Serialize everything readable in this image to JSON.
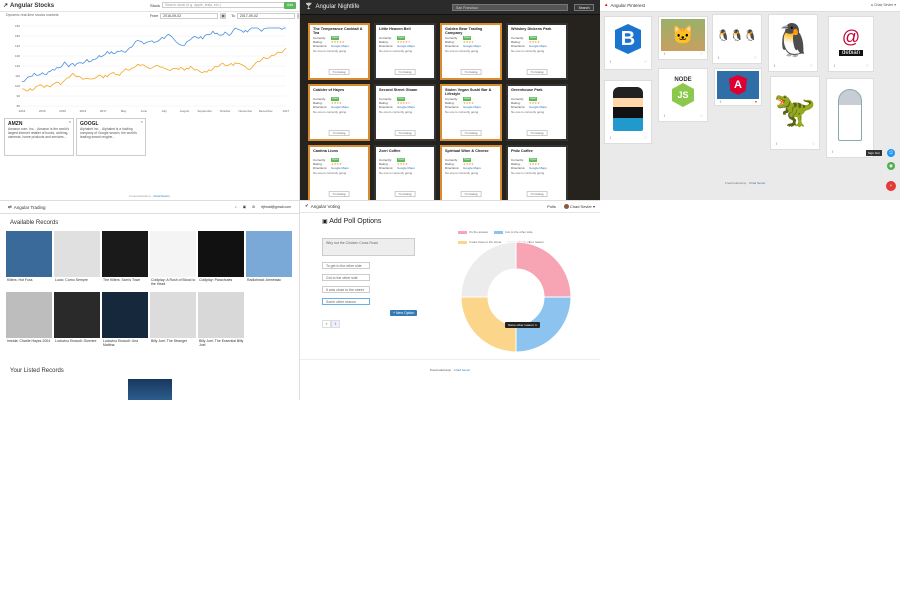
{
  "stocks": {
    "brand": "Angular Stocks",
    "subtitle": "Dynamic real-time stocks markets",
    "search_label": "Stock",
    "search_placeholder": "Search stock (e.g. apple, tesla, etc.)",
    "add_label": "Add",
    "from_label": "From",
    "from_value": "2016-09-02",
    "to_label": "To",
    "to_value": "2017-09-02",
    "x_ticks": [
      "2016",
      "2016",
      "2016",
      "2016",
      "2017",
      "May",
      "June",
      "July",
      "August",
      "September",
      "October",
      "November",
      "December",
      "2017"
    ],
    "y_ticks": [
      "160",
      "150",
      "140",
      "130",
      "120",
      "110",
      "100",
      "90",
      "80"
    ],
    "cards": [
      {
        "symbol": "AMZN",
        "text": "Amazon.com, Inc. - Amazon is the world's largest internet retailer of books, clothing, cameras, home products and services..."
      },
      {
        "symbol": "GOOGL",
        "text": "Alphabet Inc. - Alphabet is a holding company of Google search, the world's leading search engine..."
      }
    ],
    "footer_text": "FreeCodeCamp",
    "footer_author": "Chad Sevier",
    "series_colors": {
      "amzn": "#4a90e2",
      "googl": "#f5a623"
    }
  },
  "nightlife": {
    "brand": "Angular Nightlife",
    "search_placeholder": "San Francisco",
    "search_button": "Search",
    "labels": {
      "currently": "Currently:",
      "rating": "Rating:",
      "directions": "Directions:",
      "going": "I'm Going",
      "open": "Open",
      "maps": "Google Maps",
      "reviews": "No one is currently going"
    },
    "bars": [
      {
        "name": "The Temperance Cocktail & Tea",
        "stars": "★★★★★",
        "dark": false
      },
      {
        "name": "Little Heaven Bell",
        "stars": "★★★★½",
        "dark": true
      },
      {
        "name": "Golden Bear Trading Company",
        "stars": "★★★★",
        "dark": false
      },
      {
        "name": "Whiskey Dickens Park",
        "stars": "★★★★",
        "dark": true
      },
      {
        "name": "Cobbler of Hayes",
        "stars": "★★★★",
        "dark": false
      },
      {
        "name": "Second Street Gloam",
        "stars": "★★★★½",
        "dark": true
      },
      {
        "name": "Stolen Vegan Sushi Bar & Lifestyle",
        "stars": "★★★★",
        "dark": false
      },
      {
        "name": "Greenhouse Park",
        "stars": "★★★★",
        "dark": true
      },
      {
        "name": "Cantina Lions",
        "stars": "★★★★",
        "dark": false
      },
      {
        "name": "Zorri Coffee",
        "stars": "★★★★",
        "dark": true
      },
      {
        "name": "Spiritual Wine & Cheese",
        "stars": "★★★★",
        "dark": false
      },
      {
        "name": "Philz Coffee",
        "stars": "★★★★",
        "dark": true
      }
    ]
  },
  "pinterest": {
    "brand": "Angular Pinterest",
    "user": "Chad Sevier",
    "footer_text": "FreeCodeCamp",
    "footer_author": "Chad Sevier",
    "pins": [
      {
        "name": "Bootstrap",
        "glyph": "B"
      },
      {
        "name": "Kitten",
        "glyph": "🐱"
      },
      {
        "name": "Linux Penguins",
        "glyph": "🐧🐧🐧"
      },
      {
        "name": "Tux",
        "glyph": "🐧"
      },
      {
        "name": "debian",
        "glyph": "@"
      },
      {
        "name": "Johnny Bravo",
        "glyph": "🕶"
      },
      {
        "name": "NODE",
        "glyph": "JS"
      },
      {
        "name": "Angular",
        "glyph": "A"
      },
      {
        "name": "Dinosaur",
        "glyph": "🦖"
      },
      {
        "name": "R2-D2",
        "glyph": "🤖"
      }
    ],
    "fab_labels": [
      "Sign Out",
      "+"
    ]
  },
  "trading": {
    "brand": "Angular Trading",
    "user": "rtjfmail@gmail.com",
    "available_heading": "Available Records",
    "listed_heading": "Your Listed Records",
    "records": [
      {
        "title": "Killers: Hot Fuss",
        "bg": "#3a6a9a",
        "fg": "#fff"
      },
      {
        "title": "Lucio: Como Sempre",
        "bg": "#e0e0e0",
        "fg": "#888"
      },
      {
        "title": "The Killers: Sam's Town",
        "bg": "#1a1a1a",
        "fg": "#ddd"
      },
      {
        "title": "Coldplay: A Rush of Blood to the Head",
        "bg": "#f4f4f4",
        "fg": "#333"
      },
      {
        "title": "Coldplay: Parachutes",
        "bg": "#111",
        "fg": "#e8a500"
      },
      {
        "title": "Radiohead: Amnesiac",
        "bg": "#7aa9d8",
        "fg": "#fff"
      },
      {
        "title": "Imelda: Charlie Hayes 2004",
        "bg": "#bdbdbd",
        "fg": "#444"
      },
      {
        "title": "Ludovico Einaudi: Divenire",
        "bg": "#2a2a2a",
        "fg": "#ddd"
      },
      {
        "title": "Ludovico Einaudi: Una Mattina",
        "bg": "#16283c",
        "fg": "#fff"
      },
      {
        "title": "Billy Joel: The Stranger",
        "bg": "#dcdcdc",
        "fg": "#333"
      },
      {
        "title": "Billy Joel: The Essential Billy Joel",
        "bg": "#d8d8d8",
        "fg": "#c00"
      }
    ]
  },
  "voting": {
    "brand": "Angular Voting",
    "nav_links": [
      "Polls",
      "Chad Sevier"
    ],
    "heading": "Add Poll Options",
    "question": "Why not the Chicken Cross Road",
    "options": [
      "To get to the other side",
      "Got to the other side",
      "It was close to the street",
      "Some other reason"
    ],
    "add_button": "+ New Option",
    "pager": [
      "«",
      "1"
    ],
    "legend": [
      "It's the answer",
      "Got to the other side",
      "It was close to the street",
      "Some other reason"
    ],
    "tooltip": "Some other reason: 1",
    "footer_text": "FreeCodeCamp",
    "footer_author": "Chad Sevier"
  },
  "chart_data": {
    "type": "pie",
    "categories": [
      "It's the answer",
      "Got to the other side",
      "It was close to the street",
      "Some other reason"
    ],
    "values": [
      1,
      1,
      1,
      1
    ],
    "colors": [
      "#f7a4b4",
      "#8dc4ef",
      "#fbd68a",
      "#ececec"
    ]
  }
}
